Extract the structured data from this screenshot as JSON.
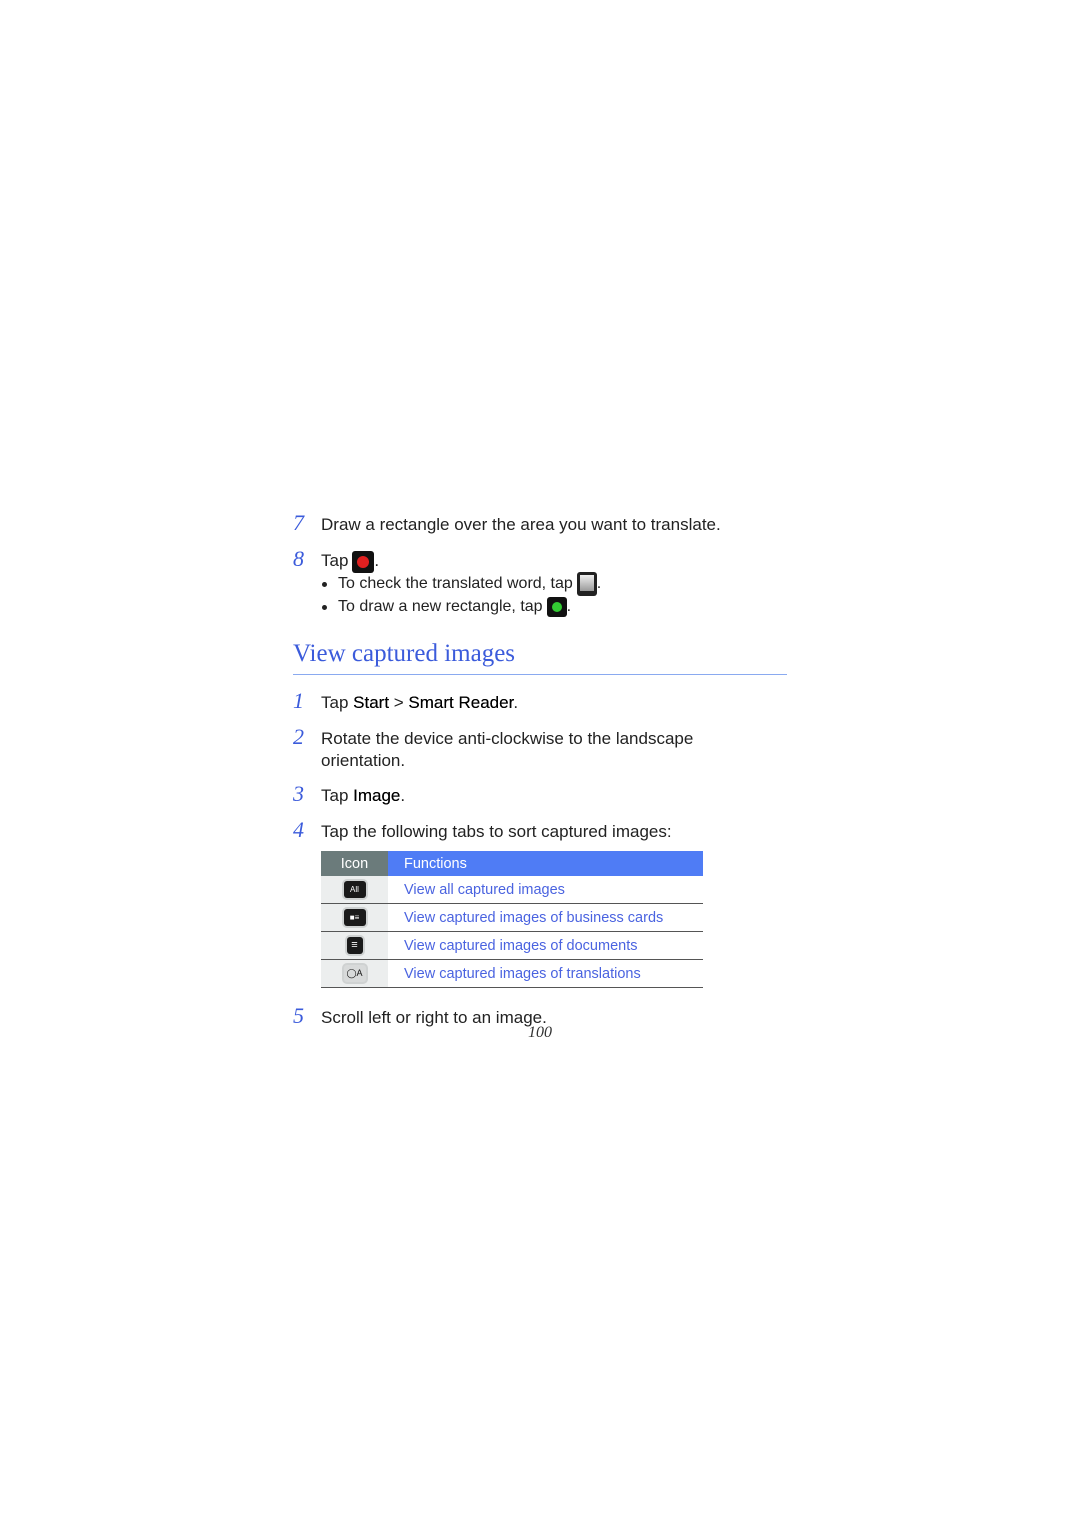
{
  "steps_top": [
    {
      "number": "7",
      "text": "Draw a rectangle over the area you want to translate."
    },
    {
      "number": "8",
      "text_before": "Tap",
      "text_after": ".",
      "icon": "record-button-icon"
    }
  ],
  "bullets": [
    {
      "text": "To check the translated word, tap",
      "icon": "translated-word-icon",
      "suffix": "."
    },
    {
      "text": "To draw a new rectangle, tap",
      "icon": "new-rectangle-icon",
      "suffix": "."
    }
  ],
  "section": {
    "title": "View captured images",
    "steps": [
      {
        "number": "1",
        "prefix": "Tap ",
        "bold1": "Start",
        "sep": " > ",
        "bold2": "Smart Reader",
        "suffix": "."
      },
      {
        "number": "2",
        "text_line1": "Rotate the device anti-clockwise to the landscape",
        "text_line2": "orientation."
      },
      {
        "number": "3",
        "prefix": "Tap ",
        "bold": "Image",
        "suffix": "."
      },
      {
        "number": "4",
        "text": "Tap the following tabs to sort captured images:"
      },
      {
        "number": "5",
        "text": "Scroll left or right to an image."
      }
    ],
    "table": {
      "headers": {
        "icon": "Icon",
        "functions": "Functions"
      },
      "rows": [
        {
          "icon": "all-images-tab-icon",
          "icon_label": "All",
          "function": "View all captured images"
        },
        {
          "icon": "business-cards-tab-icon",
          "icon_label": "",
          "function": "View captured images of business cards"
        },
        {
          "icon": "documents-tab-icon",
          "icon_label": "",
          "function": "View captured images of documents"
        },
        {
          "icon": "translations-tab-icon",
          "icon_label": "",
          "function": "View captured images of translations"
        }
      ]
    }
  },
  "colors": {
    "accent_blue": "#3b5bdb",
    "table_header_icon": "#6b7b7b",
    "table_header_functions": "#4f7cf5",
    "record_red": "#e02020",
    "new_green": "#33cc33"
  },
  "page_number": "100"
}
